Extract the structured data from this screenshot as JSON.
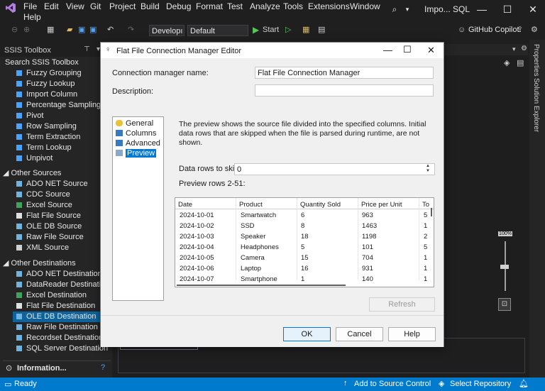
{
  "menu": {
    "items": [
      "File",
      "Edit",
      "View",
      "Git",
      "Project",
      "Build",
      "Debug",
      "Format",
      "Test",
      "Analyze",
      "Tools",
      "Extensions",
      "Window"
    ],
    "help": "Help",
    "window_title": "Impo... SQL"
  },
  "toolbar": {
    "config": "Developı",
    "platform": "Default",
    "start": "Start",
    "copilot": "GitHub Copilot"
  },
  "toolbox": {
    "title": "SSIS Toolbox",
    "search": "Search SSIS Toolbox",
    "transforms": [
      "Fuzzy Grouping",
      "Fuzzy Lookup",
      "Import Column",
      "Percentage Sampling",
      "Pivot",
      "Row Sampling",
      "Term Extraction",
      "Term Lookup",
      "Unpivot"
    ],
    "sources_group": "Other Sources",
    "sources": [
      "ADO NET Source",
      "CDC Source",
      "Excel Source",
      "Flat File Source",
      "OLE DB Source",
      "Raw File Source",
      "XML Source"
    ],
    "destinations_group": "Other Destinations",
    "destinations": [
      "ADO NET Destination",
      "DataReader Destination",
      "Excel Destination",
      "Flat File Destination",
      "OLE DB Destination",
      "Raw File Destination",
      "Recordset Destination",
      "SQL Server Destination"
    ],
    "info": "Information..."
  },
  "right_tabs": [
    "Properties",
    "Solution Explorer"
  ],
  "zoom": "100%",
  "status": {
    "ready": "Ready",
    "source_control": "Add to Source Control",
    "repo": "Select Repository"
  },
  "dialog": {
    "title": "Flat File Connection Manager Editor",
    "name_label": "Connection manager name:",
    "name_value": "Flat File Connection Manager",
    "desc_label": "Description:",
    "nav": [
      "General",
      "Columns",
      "Advanced",
      "Preview"
    ],
    "preview_text": "The preview shows the source file divided into the specified columns. Initial data rows that are skipped when the file is parsed during runtime, are not shown.",
    "skip_label": "Data rows to skip:",
    "skip_value": "0",
    "rows_label": "Preview rows 2-51:",
    "columns": [
      "Date",
      "Product",
      "Quantity Sold",
      "Price per Unit",
      "To"
    ],
    "rows": [
      [
        "2024-10-01",
        "Smartwatch",
        "6",
        "963",
        "5"
      ],
      [
        "2024-10-02",
        "SSD",
        "8",
        "1463",
        "1"
      ],
      [
        "2024-10-03",
        "Speaker",
        "18",
        "1198",
        "2"
      ],
      [
        "2024-10-04",
        "Headphones",
        "5",
        "101",
        "5"
      ],
      [
        "2024-10-05",
        "Camera",
        "15",
        "704",
        "1"
      ],
      [
        "2024-10-06",
        "Laptop",
        "16",
        "931",
        "1"
      ],
      [
        "2024-10-07",
        "Smartphone",
        "1",
        "140",
        "1"
      ]
    ],
    "refresh": "Refresh",
    "ok": "OK",
    "cancel": "Cancel",
    "help": "Help"
  },
  "colors": {
    "accent": "#007acc",
    "selection": "#0e639c",
    "dialog_bg": "#f0f0f0"
  }
}
